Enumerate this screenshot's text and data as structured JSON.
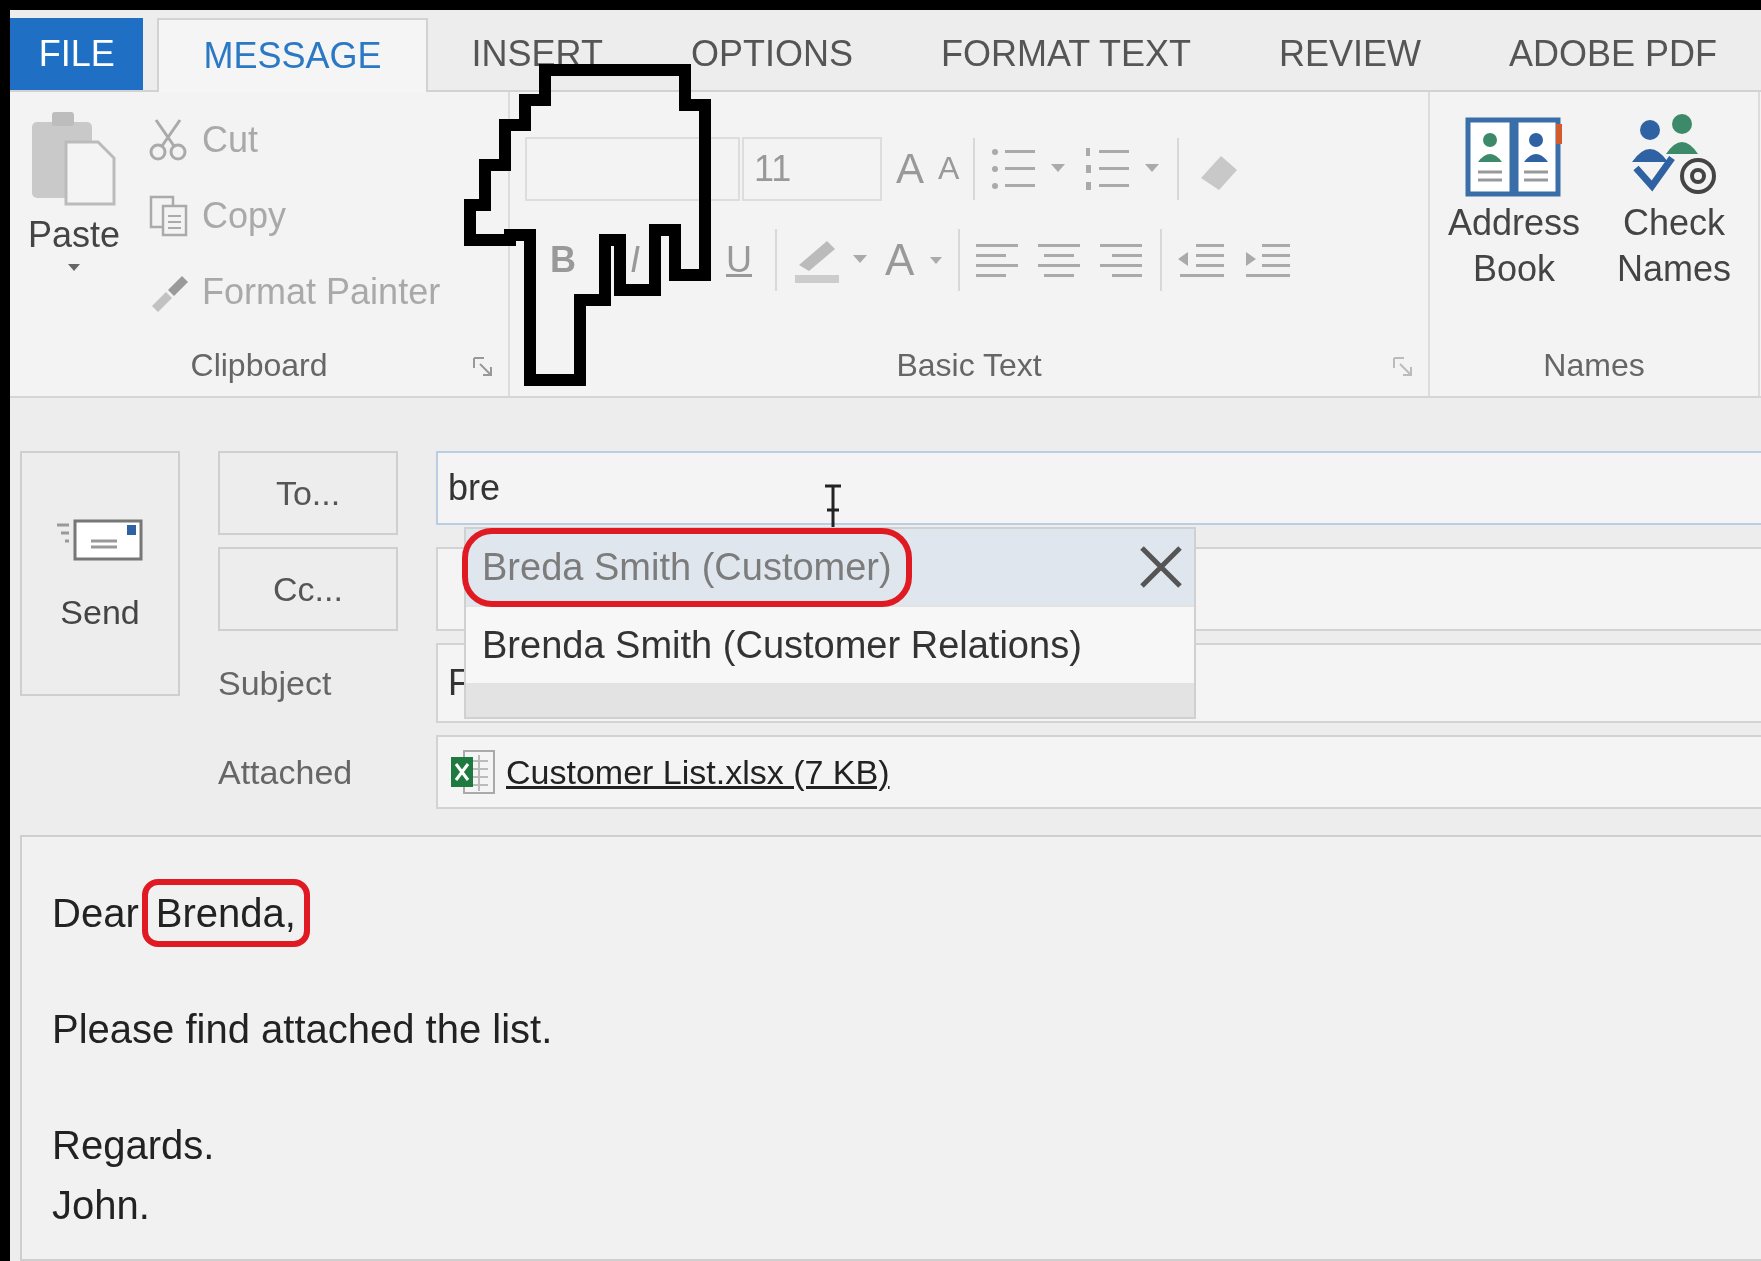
{
  "tabs": [
    {
      "label": "FILE",
      "kind": "file",
      "selected": false
    },
    {
      "label": "MESSAGE",
      "kind": "tab",
      "selected": true
    },
    {
      "label": "INSERT",
      "kind": "tab",
      "selected": false
    },
    {
      "label": "OPTIONS",
      "kind": "tab",
      "selected": false
    },
    {
      "label": "FORMAT TEXT",
      "kind": "tab",
      "selected": false
    },
    {
      "label": "REVIEW",
      "kind": "tab",
      "selected": false
    },
    {
      "label": "ADOBE PDF",
      "kind": "tab",
      "selected": false
    }
  ],
  "clipboard": {
    "label": "Clipboard",
    "paste": {
      "label": "Paste",
      "disabled": false
    },
    "actions": [
      {
        "label": "Cut",
        "kind": "cut",
        "disabled": true
      },
      {
        "label": "Copy",
        "kind": "copy",
        "disabled": true
      },
      {
        "label": "Format Painter",
        "kind": "painter",
        "disabled": true
      }
    ]
  },
  "basic_text": {
    "label": "Basic Text",
    "font_size": "11",
    "grow_font": "A",
    "shrink_font": "A",
    "format_buttons": [
      "B",
      "I",
      "U"
    ],
    "font_color": "A",
    "disabled": true
  },
  "names": {
    "label": "Names",
    "address_book": "Address Book",
    "check_names": "Check Names"
  },
  "compose": {
    "send": "Send",
    "to_button": "To...",
    "cc_button": "Cc...",
    "subject_label": "Subject",
    "attached_label": "Attached",
    "to_value": "bre",
    "subject_value": "F",
    "attachment": "Customer List.xlsx (7 KB)"
  },
  "suggestions": [
    {
      "label": "Breda Smith (Customer)",
      "selected": true,
      "circled": true
    },
    {
      "label": "Brenda Smith (Customer Relations)",
      "selected": false,
      "circled": false
    }
  ],
  "body": {
    "salutation": "Dear",
    "name": "Brenda,",
    "name_circled": true,
    "paragraphs": [
      "Please find attached the list."
    ],
    "closing": [
      "Regards.",
      "John."
    ]
  }
}
